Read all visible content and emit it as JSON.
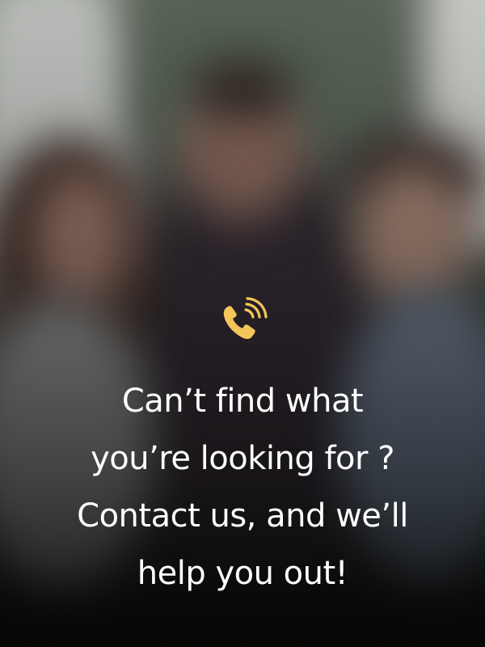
{
  "icon": {
    "name": "phone-ringing-icon",
    "color": "#f4c55a"
  },
  "message": {
    "lines": [
      "Can’t find what",
      "you’re looking for ?",
      "Contact us, and we’ll",
      "help you out!"
    ]
  }
}
